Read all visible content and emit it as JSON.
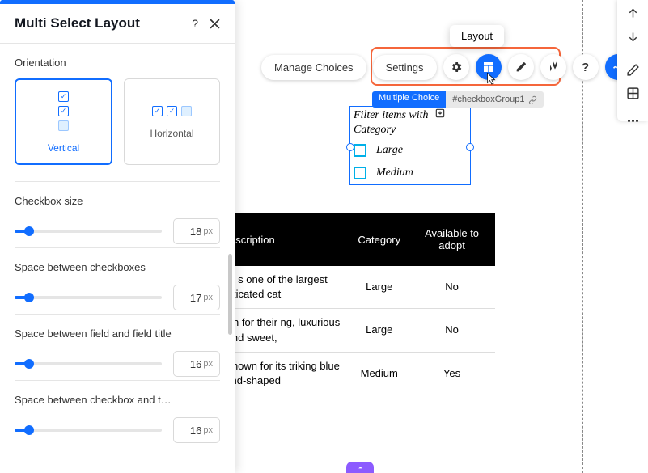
{
  "panel": {
    "title": "Multi Select Layout",
    "sections": {
      "orientation": {
        "label": "Orientation",
        "options": {
          "vertical": "Vertical",
          "horizontal": "Horizontal"
        }
      },
      "checkbox_size": {
        "label": "Checkbox size",
        "value": "18",
        "unit": "px"
      },
      "space_checkboxes": {
        "label": "Space between checkboxes",
        "value": "17",
        "unit": "px"
      },
      "space_field_title": {
        "label": "Space between field and field title",
        "value": "16",
        "unit": "px"
      },
      "space_checkbox_text": {
        "label": "Space between checkbox and t…",
        "value": "16",
        "unit": "px"
      }
    }
  },
  "tooltip": {
    "layout": "Layout"
  },
  "toolbar": {
    "manage_choices": "Manage Choices",
    "settings": "Settings"
  },
  "element": {
    "badge": "Multiple Choice",
    "id": "#checkboxGroup1"
  },
  "widget": {
    "title": "Filter items with Category",
    "options": [
      "Large",
      "Medium"
    ]
  },
  "table": {
    "headers": [
      "Description",
      "Category",
      "Available to adopt"
    ],
    "rows": [
      {
        "desc": "e Maine Coon s one of the largest nesticated cat",
        "category": "Large",
        "adopt": "No"
      },
      {
        "desc": "sian cats are own for their ng, luxurious r and sweet,",
        "category": "Large",
        "adopt": "No"
      },
      {
        "desc": "e Siamese cat known for its triking blue mond-shaped",
        "category": "Medium",
        "adopt": "Yes"
      }
    ]
  }
}
